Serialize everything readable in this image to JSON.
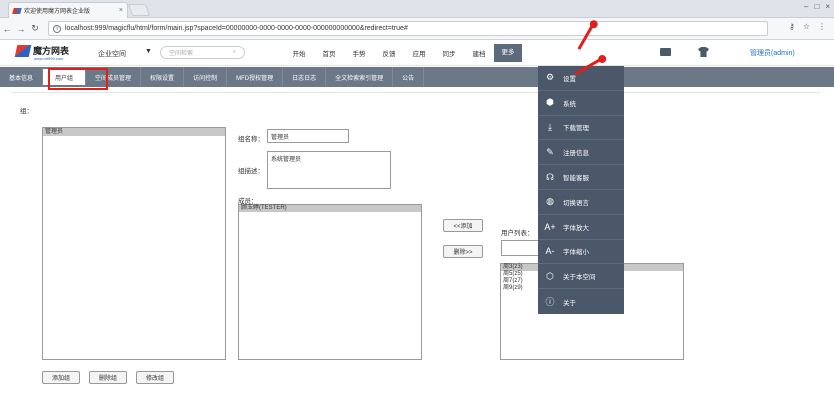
{
  "browser": {
    "tab_title": "欢迎使用魔方网表企业版",
    "url": "localhost:999/magicflu/html/form/main.jsp?spaceId=00000000-0000-0000-0000-000000000000&redirect=true#"
  },
  "header": {
    "brand": "魔方网表",
    "brand_sub": "www.mf999.com",
    "space": "企业空间",
    "search_placeholder": "空间检索",
    "nav": [
      "开始",
      "首页",
      "手势",
      "反馈",
      "应用",
      "同步",
      "建档",
      "更多"
    ],
    "user": "管理员(admin)"
  },
  "subtabs": [
    "基本信息",
    "用户组",
    "空间成员管理",
    "权限设置",
    "访问控制",
    "MFD授权管理",
    "日志日志",
    "全文检索索引管理",
    "公告"
  ],
  "form": {
    "group_label": "组：",
    "group_list": [
      "管理员"
    ],
    "name_label": "组名称：",
    "name_value": "管理员",
    "desc_label": "组描述：",
    "desc_value": "系统管理员",
    "members_label": "成员：",
    "members": [
      "顾玉婷(TESTER)"
    ],
    "add_btn": "<<添加",
    "remove_btn": "删除>>",
    "userlist_label": "用户列表：",
    "users": [
      "周3(z3)",
      "周5(z5)",
      "周7(z7)",
      "周9(z9)"
    ],
    "btn_add_group": "添加组",
    "btn_delete_group": "删除组",
    "btn_edit_group": "修改组"
  },
  "dropdown": [
    {
      "label": "设置",
      "icon": "gear-icon"
    },
    {
      "label": "系统",
      "icon": "system-icon"
    },
    {
      "label": "下载管理",
      "icon": "download-icon"
    },
    {
      "label": "注册信息",
      "icon": "pen-icon"
    },
    {
      "label": "智能客服",
      "icon": "headset-icon"
    },
    {
      "label": "切换语言",
      "icon": "globe-icon"
    },
    {
      "label": "字体放大",
      "icon": "font-larger-icon"
    },
    {
      "label": "字体缩小",
      "icon": "font-smaller-icon"
    },
    {
      "label": "关于本空间",
      "icon": "cube-icon"
    },
    {
      "label": "关于",
      "icon": "info-icon"
    }
  ]
}
